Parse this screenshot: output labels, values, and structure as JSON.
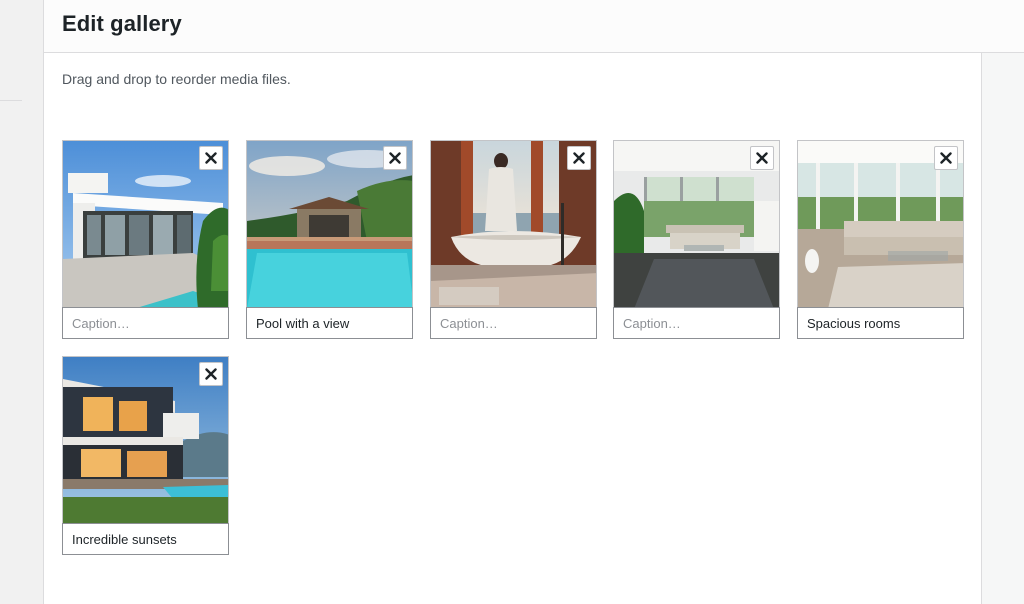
{
  "modal": {
    "title": "Edit gallery",
    "instructions": "Drag and drop to reorder media files."
  },
  "gallery": {
    "items": [
      {
        "image": "modern-white-villa",
        "caption": "",
        "placeholder": "Caption…"
      },
      {
        "image": "pool-with-gazebo",
        "caption": "Pool with a view",
        "placeholder": "Caption…"
      },
      {
        "image": "freestanding-bathtub-sea-view",
        "caption": "",
        "placeholder": "Caption…"
      },
      {
        "image": "bright-living-room",
        "caption": "",
        "placeholder": "Caption…"
      },
      {
        "image": "sunroom-sofa",
        "caption": "Spacious rooms",
        "placeholder": "Caption…"
      },
      {
        "image": "house-at-dusk",
        "caption": "Incredible sunsets",
        "placeholder": "Caption…"
      }
    ],
    "remove_icon": "close-icon"
  }
}
